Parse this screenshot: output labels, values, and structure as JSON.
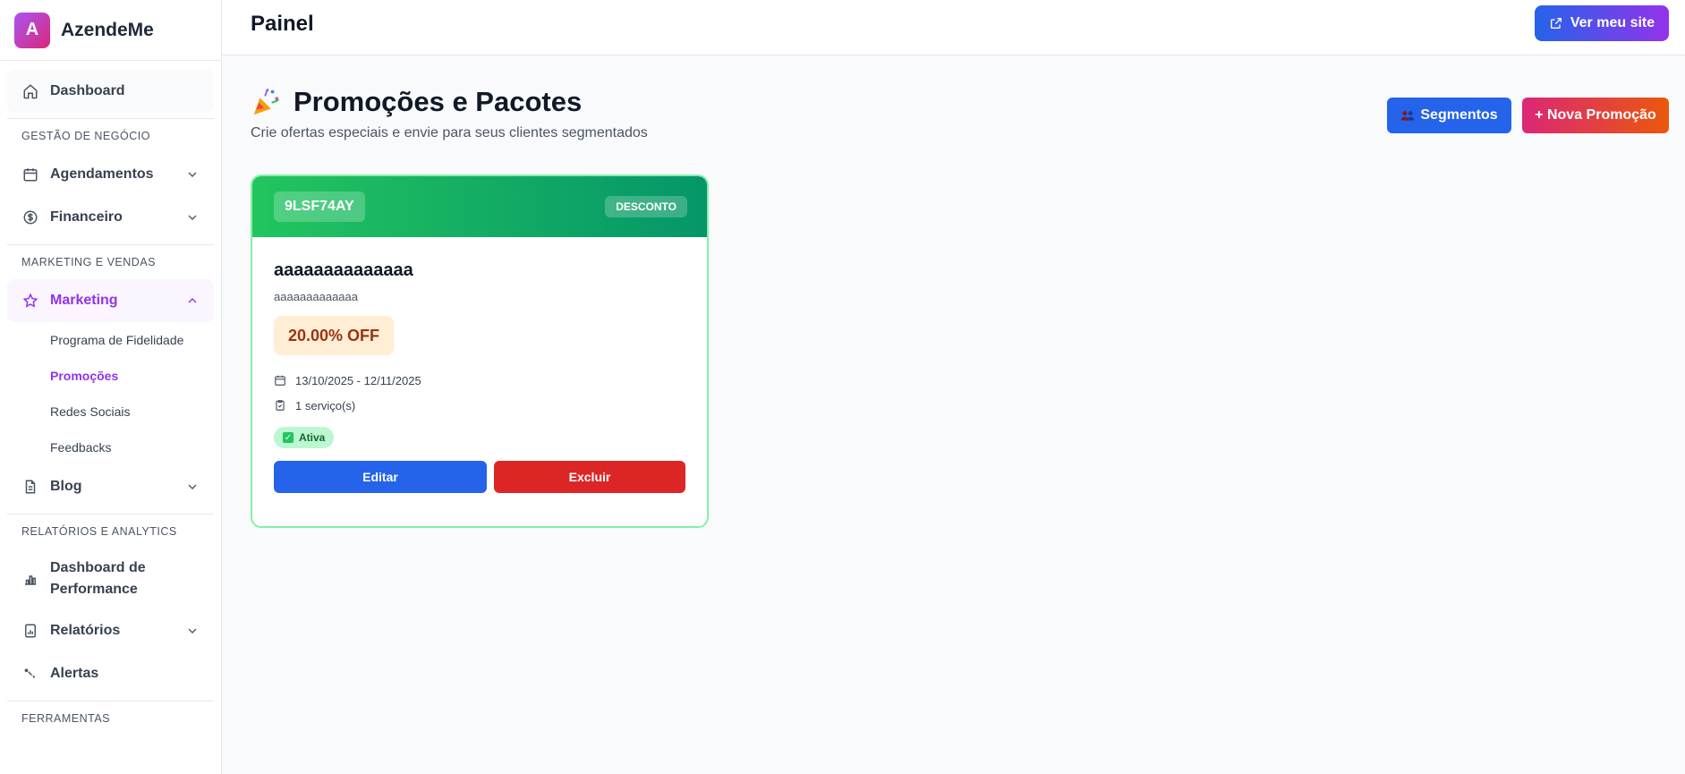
{
  "app": {
    "logo_letter": "A",
    "name": "AzendeMe"
  },
  "sidebar": {
    "dashboard": "Dashboard",
    "sections": {
      "business": "GESTÃO DE NEGÓCIO",
      "marketing": "MARKETING E VENDAS",
      "reports": "RELATÓRIOS E ANALYTICS",
      "tools": "FERRAMENTAS"
    },
    "items": {
      "agendamentos": "Agendamentos",
      "financeiro": "Financeiro",
      "marketing": "Marketing",
      "blog": "Blog",
      "performance": "Dashboard de Performance",
      "relatorios": "Relatórios",
      "alertas": "Alertas"
    },
    "marketing_sub": [
      "Programa de Fidelidade",
      "Promoções",
      "Redes Sociais",
      "Feedbacks"
    ]
  },
  "header": {
    "title": "Painel",
    "site_button": "Ver meu site"
  },
  "page": {
    "title": "Promoções e Pacotes",
    "subtitle": "Crie ofertas especiais e envie para seus clientes segmentados",
    "segments_button": "Segmentos",
    "new_button": "+ Nova Promoção"
  },
  "promotion": {
    "code": "9LSF74AY",
    "type": "DESCONTO",
    "name": "aaaaaaaaaaaaaa",
    "description": "aaaaaaaaaaaaa",
    "discount": "20.00% OFF",
    "dates": "13/10/2025 - 12/11/2025",
    "services": "1 serviço(s)",
    "status": "Ativa",
    "edit": "Editar",
    "delete": "Excluir"
  },
  "colors": {
    "accent": "#9333ea",
    "primary": "#2563eb",
    "danger": "#dc2626",
    "success": "#22c55e"
  },
  "icons": {
    "dashboard": "home-icon",
    "agendamentos": "calendar-icon",
    "financeiro": "dollar-circle-icon",
    "marketing": "star-icon",
    "blog": "document-icon",
    "performance": "bar-chart-icon",
    "relatorios": "report-icon",
    "alertas": "alert-icon"
  }
}
